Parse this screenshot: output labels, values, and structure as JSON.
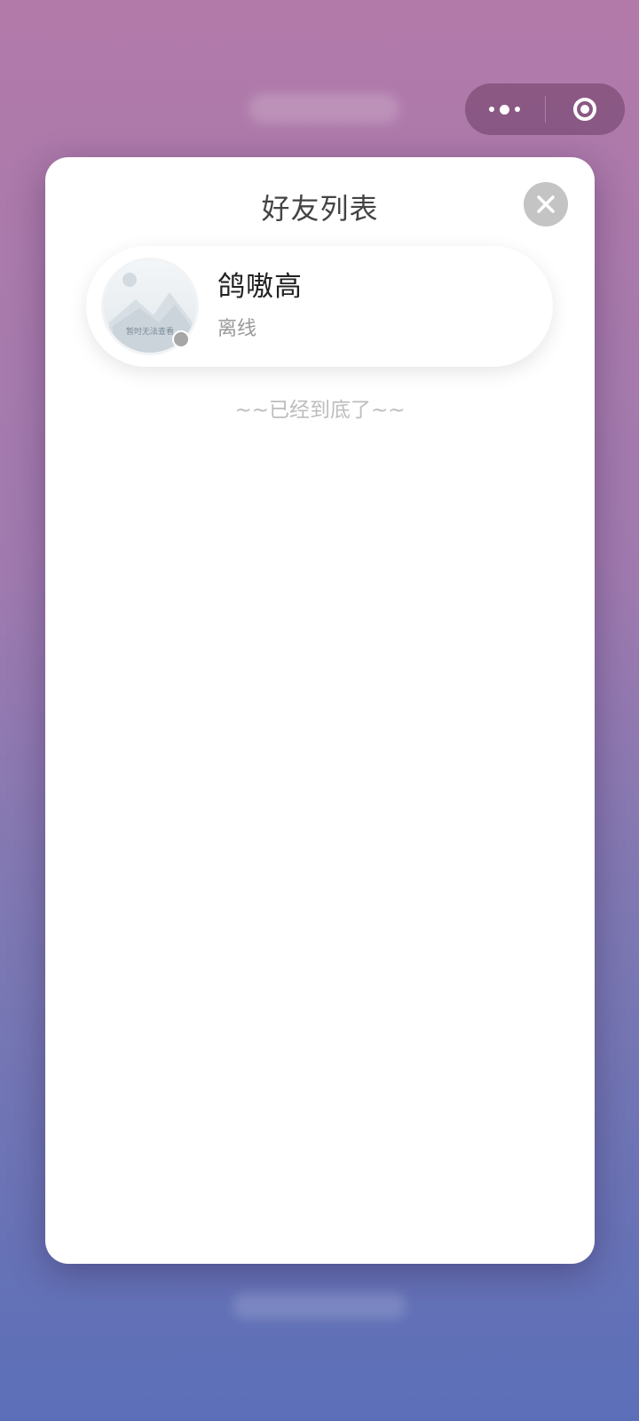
{
  "capsule": {
    "more_icon": "more-dots-icon",
    "close_icon": "target-circle-icon"
  },
  "friend_list": {
    "title": "好友列表",
    "close_icon": "close-x-icon",
    "friends": [
      {
        "name": "鸽嗷高",
        "status": "离线",
        "status_color": "#a6a6a6",
        "avatar_placeholder_text": "暂时无法查看"
      }
    ],
    "end_text": "~~已经到底了~~"
  }
}
